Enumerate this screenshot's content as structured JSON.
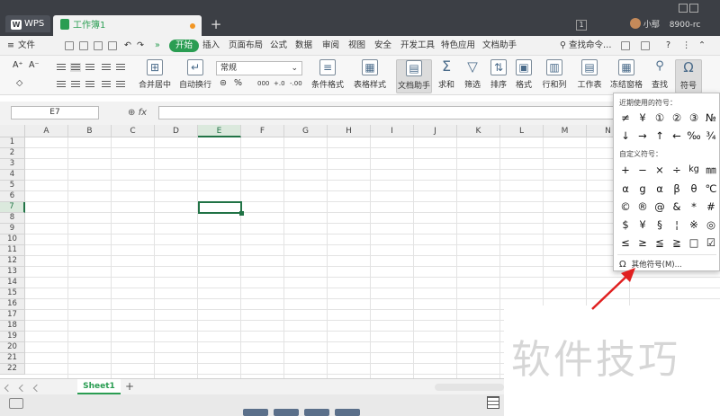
{
  "titlebar": {
    "app_tab": "WPS",
    "doc_tab": "工作簿1",
    "new_tab": "+",
    "notif_badge": "1",
    "user_name": "小鄢",
    "user_extra": "8900-rc"
  },
  "menubar": {
    "file_label": "文件",
    "items": [
      "开始",
      "插入",
      "页面布局",
      "公式",
      "数据",
      "审阅",
      "视图",
      "安全",
      "开发工具",
      "特色应用",
      "文档助手"
    ],
    "search_label": "查找命令…",
    "help": "?",
    "misc": "⋮"
  },
  "ribbon": {
    "merge_center": "合并居中",
    "wrap_text": "自动换行",
    "number_format": "常规",
    "percent": "%",
    "thousands": "000",
    "dec_inc": "+.0",
    "dec_dec": "-.00",
    "cond_format": "条件格式",
    "table_style": "表格样式",
    "doc_helper": "文档助手",
    "sum": "求和",
    "filter": "筛选",
    "sort": "排序",
    "format": "格式",
    "rows_cols": "行和列",
    "worksheet": "工作表",
    "freeze": "冻结窗格",
    "find": "查找",
    "symbol": "符号"
  },
  "formulabar": {
    "cell_ref": "E7",
    "fx": "fx",
    "content": ""
  },
  "grid": {
    "columns": [
      "A",
      "B",
      "C",
      "D",
      "E",
      "F",
      "G",
      "H",
      "I",
      "J",
      "K",
      "L",
      "M",
      "N"
    ],
    "rows": [
      "1",
      "2",
      "3",
      "4",
      "5",
      "6",
      "7",
      "8",
      "9",
      "10",
      "11",
      "12",
      "13",
      "14",
      "15",
      "16",
      "17",
      "18",
      "19",
      "20",
      "21",
      "22"
    ],
    "selected_col": "E",
    "selected_row": "7"
  },
  "sheets": {
    "active": "Sheet1",
    "add": "+"
  },
  "symbol_panel": {
    "recent_title": "近期使用的符号：",
    "recent": [
      [
        "≠",
        "¥",
        "①",
        "②",
        "③",
        "№"
      ],
      [
        "↓",
        "→",
        "↑",
        "←",
        "‰",
        "¾"
      ]
    ],
    "custom_title": "自定义符号：",
    "custom": [
      [
        "+",
        "−",
        "×",
        "÷",
        "kg",
        "㎜"
      ],
      [
        "α",
        "g",
        "α",
        "β",
        "θ",
        "℃"
      ],
      [
        "©",
        "®",
        "@",
        "&",
        "*",
        "#"
      ],
      [
        "$",
        "¥",
        "§",
        "¦",
        "※",
        "◎"
      ],
      [
        "≤",
        "≥",
        "≦",
        "≧",
        "□",
        "☑"
      ]
    ],
    "more": "其他符号(M)...",
    "omega": "Ω"
  },
  "watermark": "软件技巧",
  "colors": {
    "accent_green": "#2a9d52",
    "grid_select": "#217346",
    "tabbar_bg": "#3c3f45",
    "annotation_red": "#e02020"
  }
}
